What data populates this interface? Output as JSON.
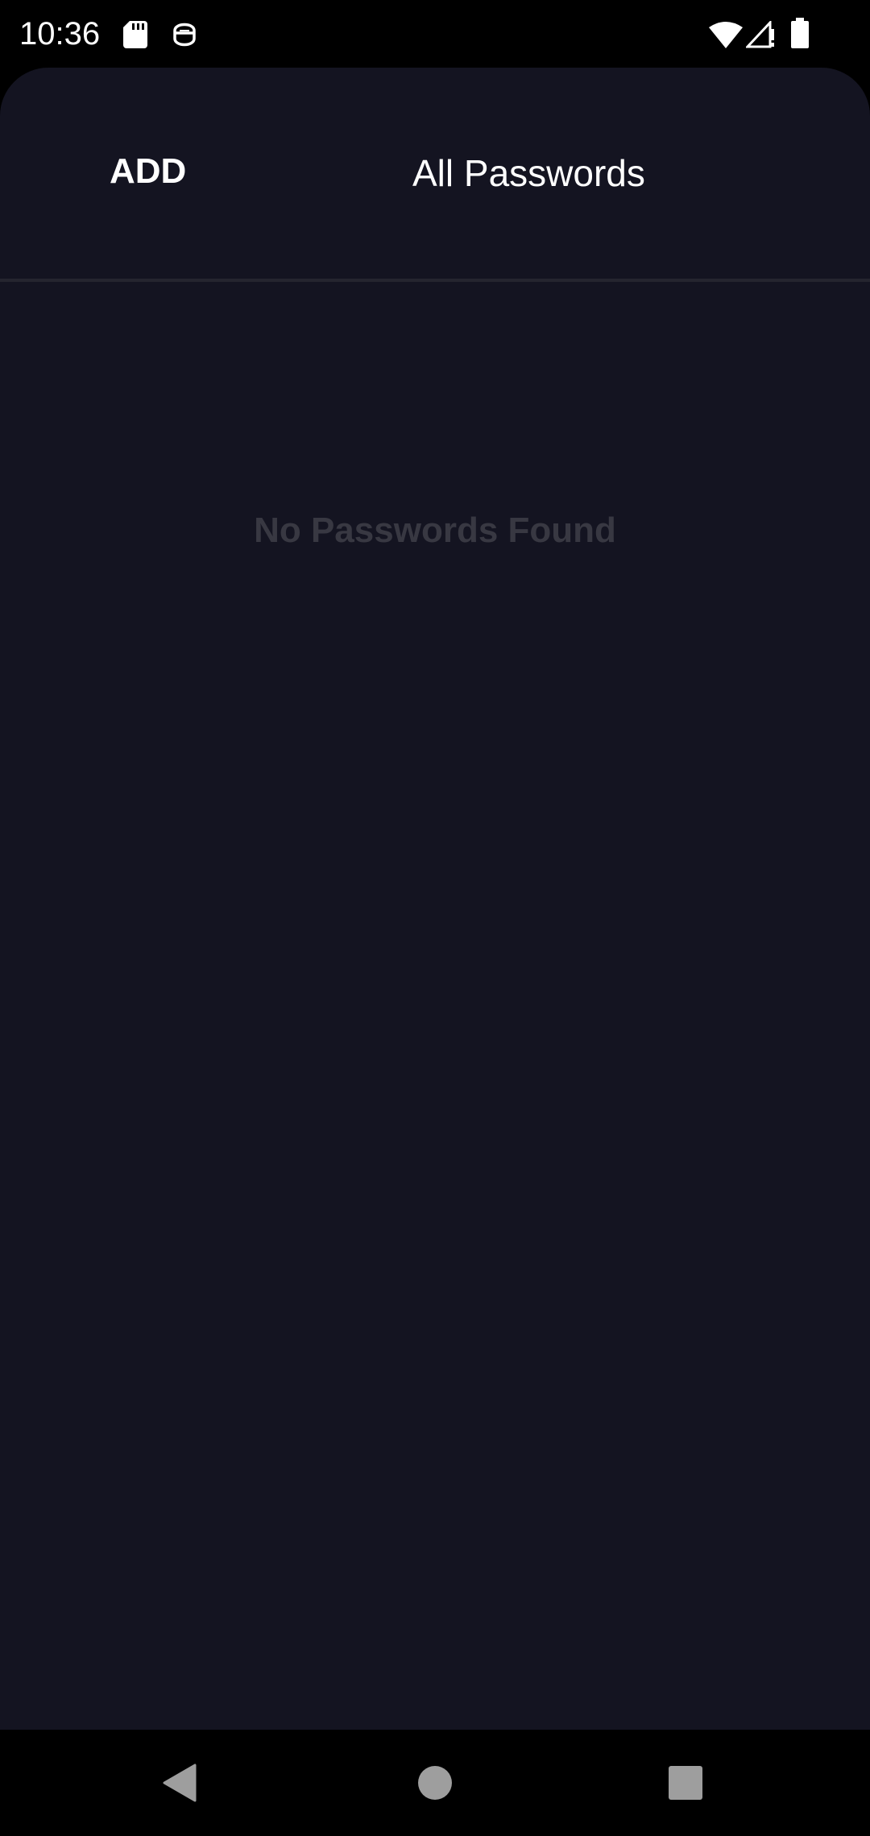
{
  "status_bar": {
    "time": "10:36",
    "icons": [
      "sd-card-icon",
      "face-icon",
      "wifi-icon",
      "signal-icon",
      "battery-icon"
    ]
  },
  "header": {
    "add_label": "ADD",
    "title": "All Passwords"
  },
  "main": {
    "empty_message": "No Passwords Found"
  },
  "nav_bar": {
    "icons": [
      "back-icon",
      "home-icon",
      "recents-icon"
    ]
  },
  "colors": {
    "app_background": "#141421",
    "divider": "#25252f",
    "empty_text": "#383842",
    "system_bar": "#000000",
    "nav_icon": "#9e9e9e"
  }
}
